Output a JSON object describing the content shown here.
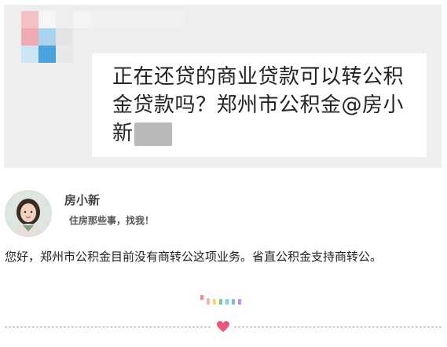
{
  "question_card": {
    "line1": "正在还贷的商业贷款可以转公积",
    "line2": "金贷款吗？郑州市公积金@房小",
    "line3": "新"
  },
  "profile": {
    "name": "房小新",
    "slogan": "住房那些事，找我！"
  },
  "answer": "您好，郑州市公积金目前没有商转公这项业务。省直公积金支持商转公。",
  "colors": {
    "mosaic_pink": "#f0aab1",
    "mosaic_light_blue": "#a9d4ee",
    "mosaic_blue": "#4aa3dc",
    "heart": "#e9577a",
    "divider_bars": [
      "#f28b82",
      "#fdd663",
      "#81c995",
      "#78d9ec",
      "#8ab4f8",
      "#c58af9"
    ]
  },
  "icons": [
    "avatar",
    "heart-icon",
    "blur-mosaic"
  ]
}
